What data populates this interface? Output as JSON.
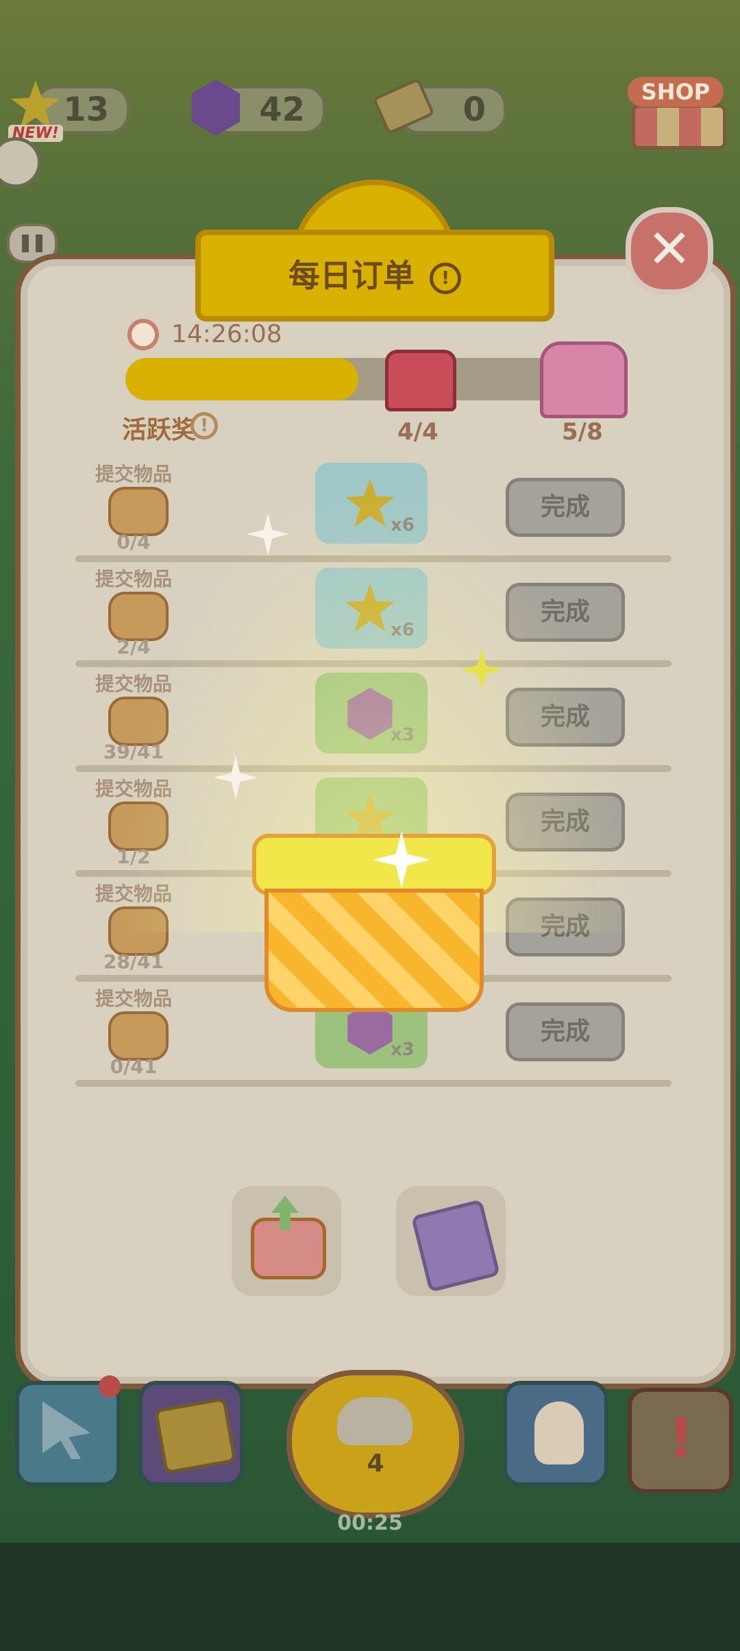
{
  "hud": {
    "stars": "13",
    "gems": "42",
    "tickets": "0",
    "new_badge": "NEW!",
    "shop_label": "SHOP"
  },
  "dialog": {
    "title": "每日订单",
    "timer": "14:26:08",
    "progress_fraction": 0.5,
    "milestone1_label": "4/4",
    "milestone2_label": "5/8",
    "activity_label": "活跃奖"
  },
  "orders": [
    {
      "submit_label": "提交物品",
      "item_icon": "croissant-icon",
      "count": "0/4",
      "reward_icon": "star-icon",
      "reward_mult": "x6",
      "reward_bg": "#9fc7c8",
      "button": "完成"
    },
    {
      "submit_label": "提交物品",
      "item_icon": "watermelon-icon",
      "count": "2/4",
      "reward_icon": "star-icon",
      "reward_mult": "x6",
      "reward_bg": "#9fc7c8",
      "button": "完成"
    },
    {
      "submit_label": "提交物品",
      "item_icon": "macaron-icon",
      "count": "39/41",
      "reward_icon": "gem-icon",
      "reward_mult": "x3",
      "reward_bg": "#9cc27e",
      "button": "完成"
    },
    {
      "submit_label": "提交物品",
      "item_icon": "cupcake-icon",
      "count": "1/2",
      "reward_icon": "star-icon",
      "reward_mult": "",
      "reward_bg": "#9cc27e",
      "button": "完成"
    },
    {
      "submit_label": "提交物品",
      "item_icon": "toast-icon",
      "count": "28/41",
      "reward_icon": "gem-icon",
      "reward_mult": "",
      "reward_bg": "#9cc27e",
      "button": "完成"
    },
    {
      "submit_label": "提交物品",
      "item_icon": "donut-icon",
      "count": "0/41",
      "reward_icon": "gem-icon",
      "reward_mult": "x3",
      "reward_bg": "#9cc27e",
      "button": "完成"
    }
  ],
  "bottom_nav": {
    "center_count": "4",
    "center_timer": "00:25"
  },
  "colors": {
    "accent_yellow": "#d9b100",
    "panel": "#d8d1c0",
    "button_disabled": "#a5a29a"
  }
}
